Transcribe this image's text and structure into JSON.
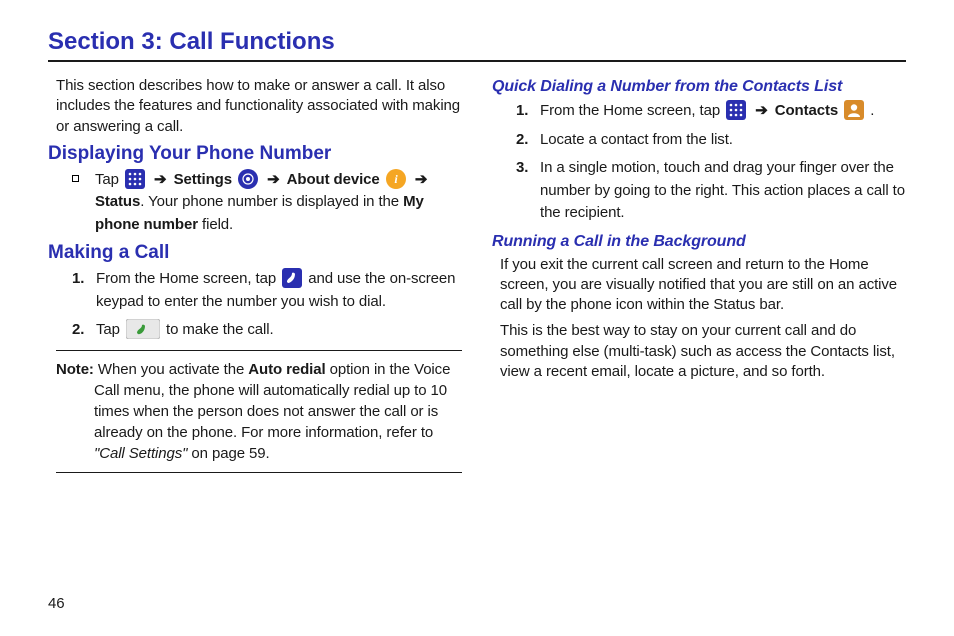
{
  "page_number": "46",
  "title": "Section 3: Call Functions",
  "left": {
    "intro": "This section describes how to make or answer a call. It also includes the features and functionality associated with making or answering a call.",
    "h2a": "Displaying Your Phone Number",
    "tap": "Tap",
    "settings": "Settings",
    "about_device": "About device",
    "status_line": ". Your phone number is displayed in the ",
    "status_bold": "Status",
    "my_phone_bold": "My phone number",
    "field_suffix": " field.",
    "h2b": "Making a Call",
    "mc1a": "From the Home screen, tap ",
    "mc1b": " and use the on-screen keypad to enter the number you wish to dial.",
    "mc2a": "Tap ",
    "mc2b": " to make the call.",
    "note_label": "Note:",
    "note_first": " When you activate the ",
    "note_auto": "Auto redial",
    "note_rest": " option in the Voice Call menu, the phone will automatically redial up to 10 times when the person does not answer the call or is already on the phone. For more information, refer to ",
    "note_ital": "\"Call Settings\"",
    "note_tail": "  on page 59."
  },
  "right": {
    "h3a": "Quick Dialing a Number from the Contacts List",
    "q1a": "From the Home screen, tap ",
    "q1_contacts": "Contacts",
    "q1b": " .",
    "q2": "Locate a contact from the list.",
    "q3": "In a single motion, touch and drag your finger over the number by going to the right. This action places a call to the recipient.",
    "h3b": "Running a Call in the Background",
    "r1": "If you exit the current call screen and return to the Home screen, you are visually notified that you are still on an active call by the phone icon within the Status bar.",
    "r2": "This is the best way to stay on your current call and do something else (multi-task) such as access the Contacts list, view a recent email, locate a picture, and so forth."
  },
  "nums": {
    "n1": "1.",
    "n2": "2.",
    "n3": "3."
  },
  "arrow": "➔"
}
